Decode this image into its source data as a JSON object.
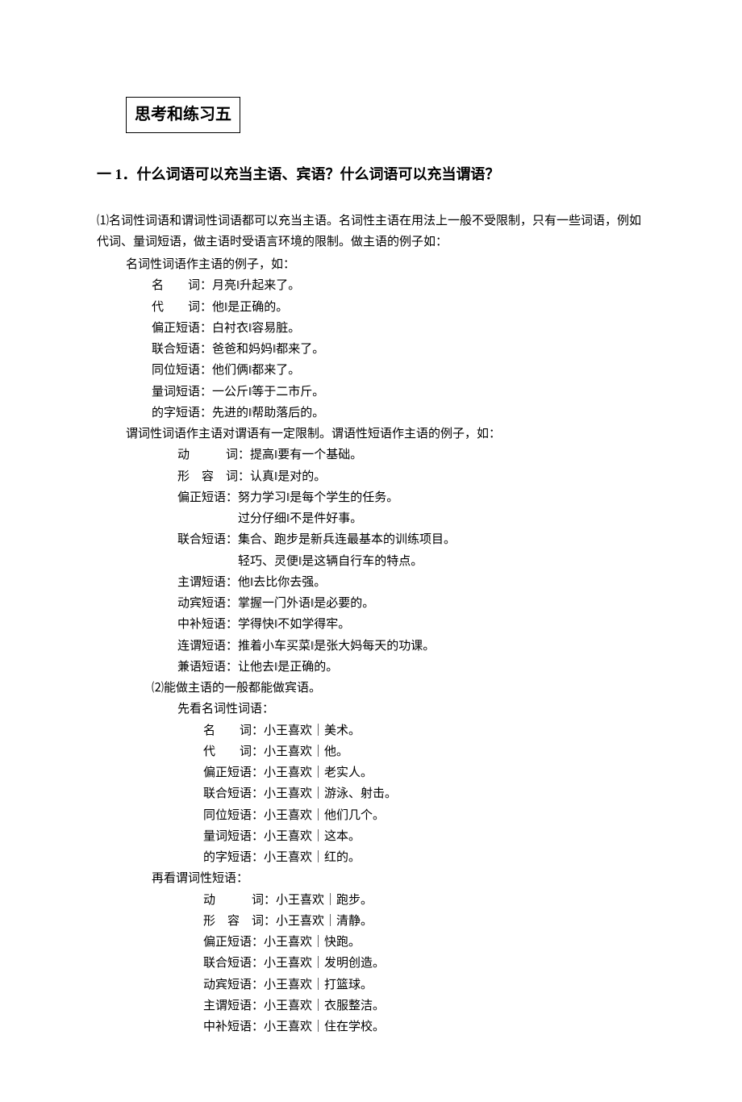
{
  "title": "思考和练习五",
  "question": "一 1．什么词语可以充当主语、宾语？什么词语可以充当谓语？",
  "intro1": "⑴名词性词语和谓词性词语都可以充当主语。名词性主语在用法上一般不受限制，只有一些词语，例如代词、量词短语，做主语时受语言环境的限制。做主语的例子如：",
  "heading_noun_subject": "名词性词语作主语的例子，如：",
  "list_a": [
    "名　　词：月亮‖升起来了。",
    "代　　词：他‖是正确的。",
    "偏正短语：白衬衣‖容易脏。",
    "联合短语：爸爸和妈妈‖都来了。",
    "同位短语：他们俩‖都来了。",
    "量词短语：一公斤‖等于二市斤。",
    "的字短语：先进的‖帮助落后的。"
  ],
  "heading_verb_subject": "谓词性词语作主语对谓语有一定限制。谓语性短语作主语的例子，如：",
  "list_b": [
    "动　　　词：提高‖要有一个基础。",
    "形　容　词：认真‖是对的。",
    "偏正短语：努力学习‖是每个学生的任务。",
    "　　　　　过分仔细‖不是件好事。",
    "联合短语：集合、跑步是新兵连最基本的训练项目。",
    "　　　　　轻巧、灵便‖是这辆自行车的特点。",
    "主谓短语：他‖去比你去强。",
    "动宾短语：掌握一门外语‖是必要的。",
    "中补短语：学得快‖不如学得牢。",
    "连谓短语：推着小车买菜‖是张大妈每天的功课。",
    "兼语短语：让他去‖是正确的。"
  ],
  "intro2": "⑵能做主语的一般都能做宾语。",
  "heading_noun_first": "先看名词性词语：",
  "list_c": [
    "名　　词：小王喜欢｜美术。",
    "代　　词：小王喜欢｜他。",
    "偏正短语：小王喜欢｜老实人。",
    "联合短语：小王喜欢｜游泳、射击。",
    "同位短语：小王喜欢｜他们几个。",
    "量词短语：小王喜欢｜这本。",
    "的字短语：小王喜欢｜红的。"
  ],
  "heading_verb_second": "再看谓词性短语：",
  "list_d": [
    "动　　　词：小王喜欢｜跑步。",
    "形　容　词：小王喜欢｜清静。",
    "偏正短语：小王喜欢｜快跑。",
    "联合短语：小王喜欢｜发明创造。",
    "动宾短语：小王喜欢｜打篮球。",
    "主谓短语：小王喜欢｜衣服整洁。",
    "中补短语：小王喜欢｜住在学校。"
  ]
}
